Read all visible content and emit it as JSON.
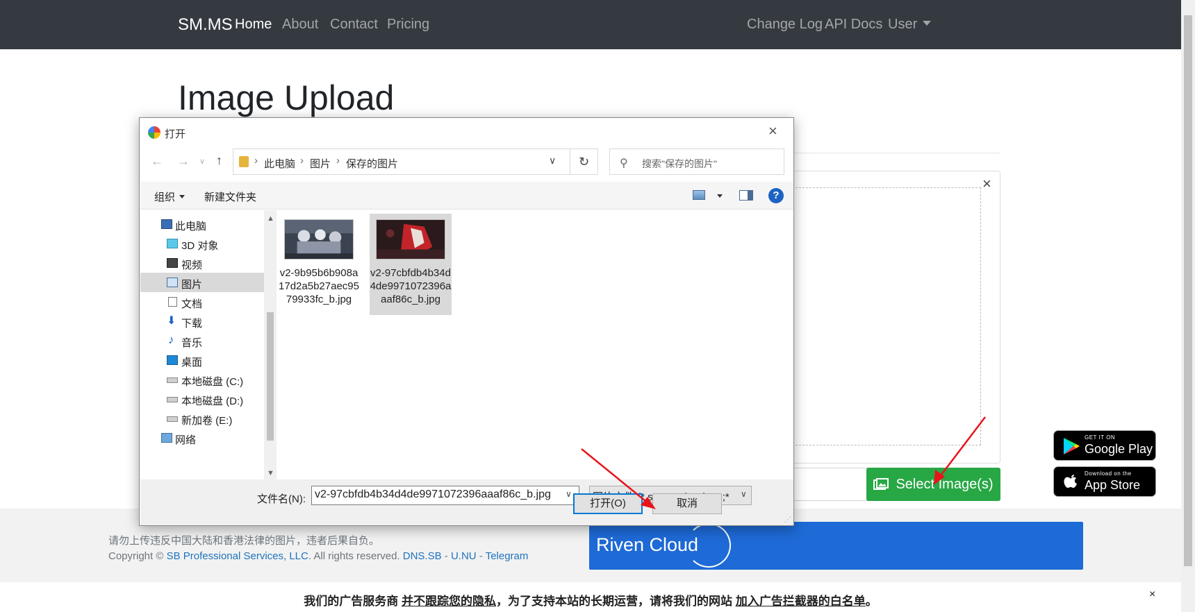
{
  "navbar": {
    "brand": "SM.MS",
    "links_left": [
      "Home",
      "About",
      "Contact",
      "Pricing"
    ],
    "links_right": [
      "Change Log",
      "API Docs",
      "User"
    ]
  },
  "page": {
    "title": "Image Upload",
    "select_button": "Select Image(s)",
    "close_symbol": "×"
  },
  "footer": {
    "warning": "请勿上传违反中国大陆和香港法律的图片，违者后果自负。",
    "copyright_prefix": "Copyright ©",
    "company": "SB Professional Services, LLC",
    "rights": ". All rights reserved.",
    "link1": "DNS.SB",
    "sep": " - ",
    "link2": "U.NU",
    "link3": "Telegram",
    "riven": "Riven Cloud"
  },
  "ad": {
    "part1": "我们的广告服务商 ",
    "part2": "并不跟踪您的隐私",
    "part3": "，为了支持本站的长期运营，请将我们的网站 ",
    "part4": "加入广告拦截器的白名单",
    "part5": "。",
    "close": "×"
  },
  "badges": {
    "google_small": "GET IT ON",
    "google_big": "Google Play",
    "apple_small": "Download on the",
    "apple_big": "App Store"
  },
  "dialog": {
    "title": "打开",
    "close": "×",
    "breadcrumb": [
      "此电脑",
      "图片",
      "保存的图片"
    ],
    "search_placeholder": "搜索\"保存的图片\"",
    "toolbar": {
      "organize": "组织",
      "new_folder": "新建文件夹",
      "help": "?"
    },
    "tree": [
      {
        "label": "此电脑",
        "icon": "computer-icon"
      },
      {
        "label": "3D 对象",
        "icon": "cube-icon"
      },
      {
        "label": "视频",
        "icon": "video-icon"
      },
      {
        "label": "图片",
        "icon": "pictures-icon"
      },
      {
        "label": "文档",
        "icon": "document-icon"
      },
      {
        "label": "下载",
        "icon": "download-icon"
      },
      {
        "label": "音乐",
        "icon": "music-icon"
      },
      {
        "label": "桌面",
        "icon": "desktop-icon"
      },
      {
        "label": "本地磁盘 (C:)",
        "icon": "drive-icon"
      },
      {
        "label": "本地磁盘 (D:)",
        "icon": "drive-icon"
      },
      {
        "label": "新加卷 (E:)",
        "icon": "drive-icon"
      },
      {
        "label": "网络",
        "icon": "network-icon"
      }
    ],
    "selected_tree_index": 3,
    "files": [
      {
        "name": "v2-9b95b6b908a17d2a5b27aec9579933fc_b.jpg",
        "selected": false
      },
      {
        "name": "v2-97cbfdb4b34d4de9971072396aaaf86c_b.jpg",
        "selected": true
      }
    ],
    "filename_label": "文件名(N):",
    "filename_value": "v2-97cbfdb4b34d4de9971072396aaaf86c_b.jpg",
    "filter_value": "图片文件 (*.svgz;*.pjp;*.jpeg;*",
    "open_button": "打开(O)",
    "cancel_button": "取消"
  },
  "colors": {
    "navbar_bg": "#343a40",
    "select_button_bg": "#28a745",
    "riven_bg": "#1e6ad6",
    "annotation_arrow": "#e8141b"
  }
}
